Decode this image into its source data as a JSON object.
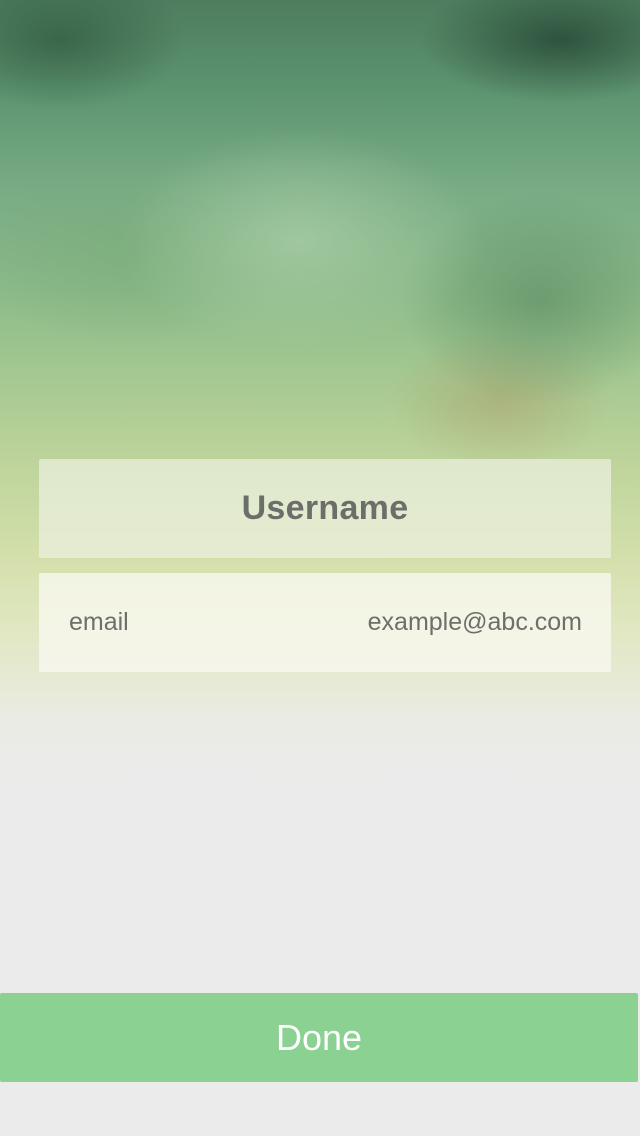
{
  "form": {
    "username_placeholder": "Username",
    "email_label": "email",
    "email_placeholder": "example@abc.com"
  },
  "actions": {
    "done_label": "Done"
  },
  "colors": {
    "accent": "#8bd191",
    "text": "#6b6e69",
    "background": "#ebebeb"
  }
}
